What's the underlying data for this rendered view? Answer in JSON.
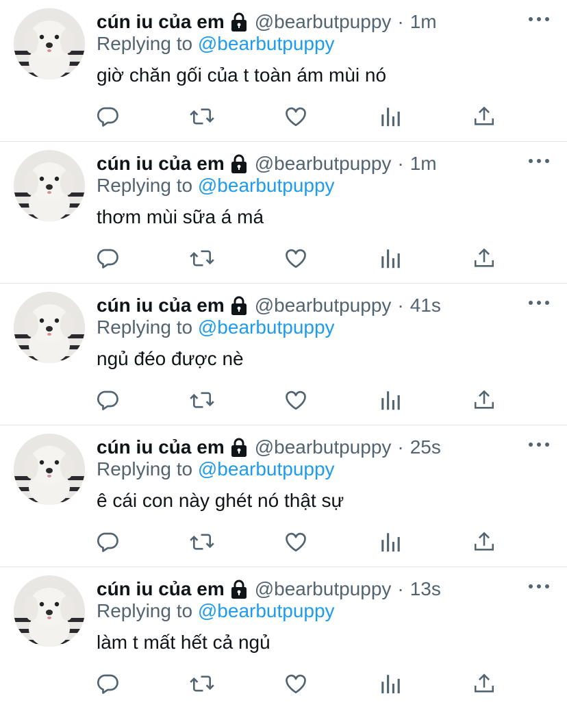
{
  "tweets": [
    {
      "display_name": "cún iu của em",
      "handle": "@bearbutpuppy",
      "separator": "·",
      "time": "1m",
      "replying_prefix": "Replying to",
      "replying_to": "@bearbutpuppy",
      "text": "giờ chăn gối của t toàn ám mùi nó"
    },
    {
      "display_name": "cún iu của em",
      "handle": "@bearbutpuppy",
      "separator": "·",
      "time": "1m",
      "replying_prefix": "Replying to",
      "replying_to": "@bearbutpuppy",
      "text": "thơm mùi sữa á má"
    },
    {
      "display_name": "cún iu của em",
      "handle": "@bearbutpuppy",
      "separator": "·",
      "time": "41s",
      "replying_prefix": "Replying to",
      "replying_to": "@bearbutpuppy",
      "text": "ngủ đéo được nè"
    },
    {
      "display_name": "cún iu của em",
      "handle": "@bearbutpuppy",
      "separator": "·",
      "time": "25s",
      "replying_prefix": "Replying to",
      "replying_to": "@bearbutpuppy",
      "text": "ê cái con này ghét nó thật sự"
    },
    {
      "display_name": "cún iu của em",
      "handle": "@bearbutpuppy",
      "separator": "·",
      "time": "13s",
      "replying_prefix": "Replying to",
      "replying_to": "@bearbutpuppy",
      "text": "làm t mất hết cả ngủ"
    }
  ],
  "icons": {
    "protected": "lock-icon",
    "more": "more-options-icon",
    "reply": "reply-icon",
    "retweet": "retweet-icon",
    "like": "heart-icon",
    "views": "views-chart-icon",
    "share": "share-icon"
  },
  "colors": {
    "link": "#1d9bf0",
    "secondary_text": "#536471",
    "primary_text": "#0f1419",
    "divider": "#e1e4e7"
  }
}
